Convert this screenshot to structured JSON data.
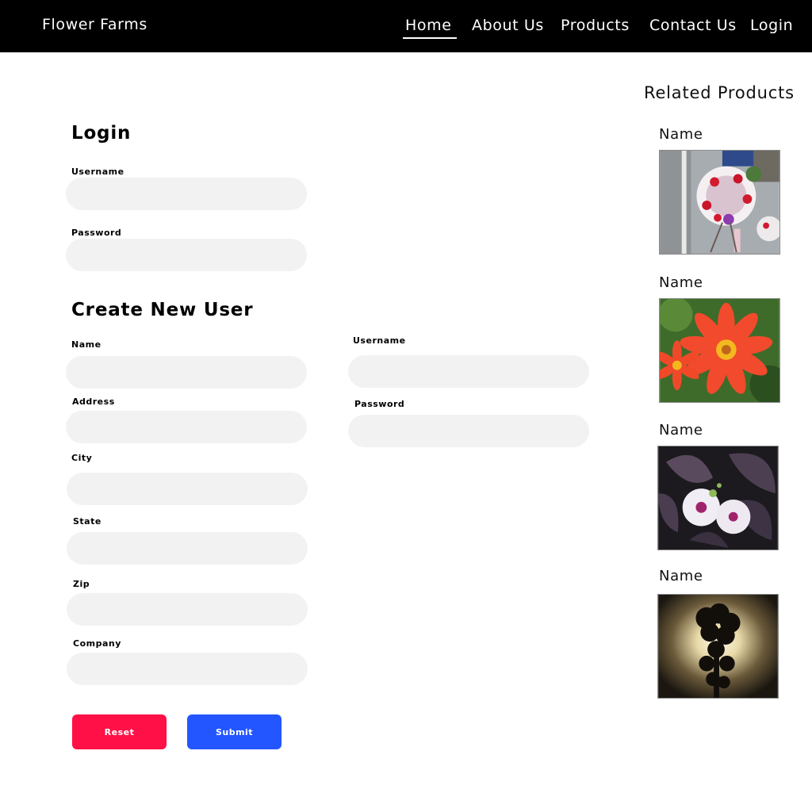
{
  "header": {
    "brand": "Flower Farms",
    "nav": [
      {
        "label": "Home",
        "active": true
      },
      {
        "label": "About Us"
      },
      {
        "label": "Products"
      },
      {
        "label": "Contact Us"
      },
      {
        "label": "Login"
      }
    ]
  },
  "login": {
    "title": "Login",
    "username_label": "Username",
    "password_label": "Password",
    "username_value": "",
    "password_value": ""
  },
  "create_user": {
    "title": "Create New User",
    "fields": {
      "name": {
        "label": "Name",
        "value": ""
      },
      "address": {
        "label": "Address",
        "value": ""
      },
      "city": {
        "label": "City",
        "value": ""
      },
      "state": {
        "label": "State",
        "value": ""
      },
      "zip": {
        "label": "Zip",
        "value": ""
      },
      "company": {
        "label": "Company",
        "value": ""
      },
      "username": {
        "label": "Username",
        "value": ""
      },
      "password": {
        "label": "Password",
        "value": ""
      }
    },
    "reset_label": "Reset",
    "submit_label": "Submit"
  },
  "related": {
    "title": "Related Products",
    "products": [
      {
        "name": "Name",
        "image": "flower-wreath-street-photo"
      },
      {
        "name": "Name",
        "image": "red-dahlia-photo"
      },
      {
        "name": "Name",
        "image": "white-morning-glory-photo"
      },
      {
        "name": "Name",
        "image": "flower-silhouette-sunset-photo"
      }
    ]
  },
  "colors": {
    "header_bg": "#000000",
    "field_bg": "#f2f2f2",
    "reset": "#ff1046",
    "submit": "#2356ff"
  }
}
